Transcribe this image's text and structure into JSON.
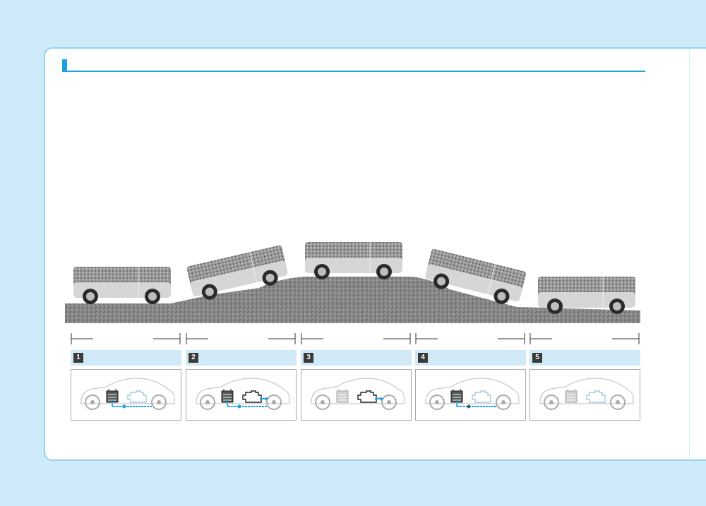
{
  "header": {
    "title": ""
  },
  "colors": {
    "background": "#cfeaf8",
    "card_border": "#8fd3f1",
    "accent": "#1aa3e0",
    "stage_bar": "#cfe9f7",
    "badge": "#3a3a3a",
    "power_flow": "#1aa3e0"
  },
  "stages": [
    {
      "number": "1",
      "label": "",
      "battery": "active",
      "engine": "inactive",
      "flow": "battery-to-wheels"
    },
    {
      "number": "2",
      "label": "",
      "battery": "active",
      "engine": "active",
      "flow": "battery-and-engine-to-wheels"
    },
    {
      "number": "3",
      "label": "",
      "battery": "inactive",
      "engine": "active",
      "flow": "engine-to-wheels"
    },
    {
      "number": "4",
      "label": "",
      "battery": "charging",
      "engine": "inactive",
      "flow": "wheels-to-battery"
    },
    {
      "number": "5",
      "label": "",
      "battery": "inactive",
      "engine": "inactive",
      "flow": "none"
    }
  ]
}
